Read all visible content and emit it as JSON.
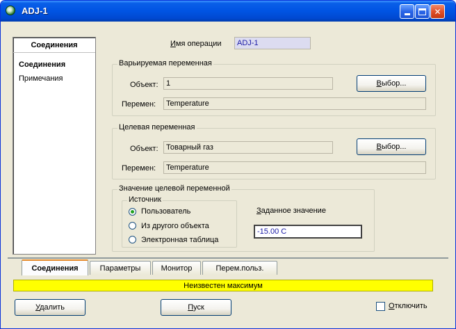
{
  "window": {
    "title": "ADJ-1"
  },
  "operation": {
    "label": "Имя операции",
    "value": "ADJ-1"
  },
  "sidebar": {
    "header": "Соединения",
    "items": [
      {
        "label": "Соединения",
        "selected": true
      },
      {
        "label": "Примечания",
        "selected": false
      }
    ]
  },
  "varied": {
    "title": "Варьируемая переменная",
    "object_label": "Объект:",
    "object_value": "1",
    "var_label": "Перемен:",
    "var_value": "Temperature",
    "select_button": "Выбор..."
  },
  "target": {
    "title": "Целевая переменная",
    "object_label": "Объект:",
    "object_value": "Товарный газ",
    "var_label": "Перемен:",
    "var_value": "Temperature",
    "select_button": "Выбор..."
  },
  "target_value": {
    "title": "Значение целевой переменной",
    "source_title": "Источник",
    "options": [
      "Пользователь",
      "Из другого объекта",
      "Электронная таблица"
    ],
    "selected_option": "Пользователь",
    "setpoint_label": "Заданное значение",
    "setpoint_value": "-15.00 C"
  },
  "tabs": [
    "Соединения",
    "Параметры",
    "Монитор",
    "Перем.польз."
  ],
  "active_tab": "Соединения",
  "status": {
    "text": "Неизвестен максимум",
    "color": "#ffff00"
  },
  "footer": {
    "delete_button": "Удалить",
    "start_button": "Пуск",
    "disable_label": "Отключить",
    "disable_checked": false
  },
  "colors": {
    "title_bar": "#0054e3",
    "link_text": "#1a1aa6",
    "status_bg": "#ffff00"
  }
}
